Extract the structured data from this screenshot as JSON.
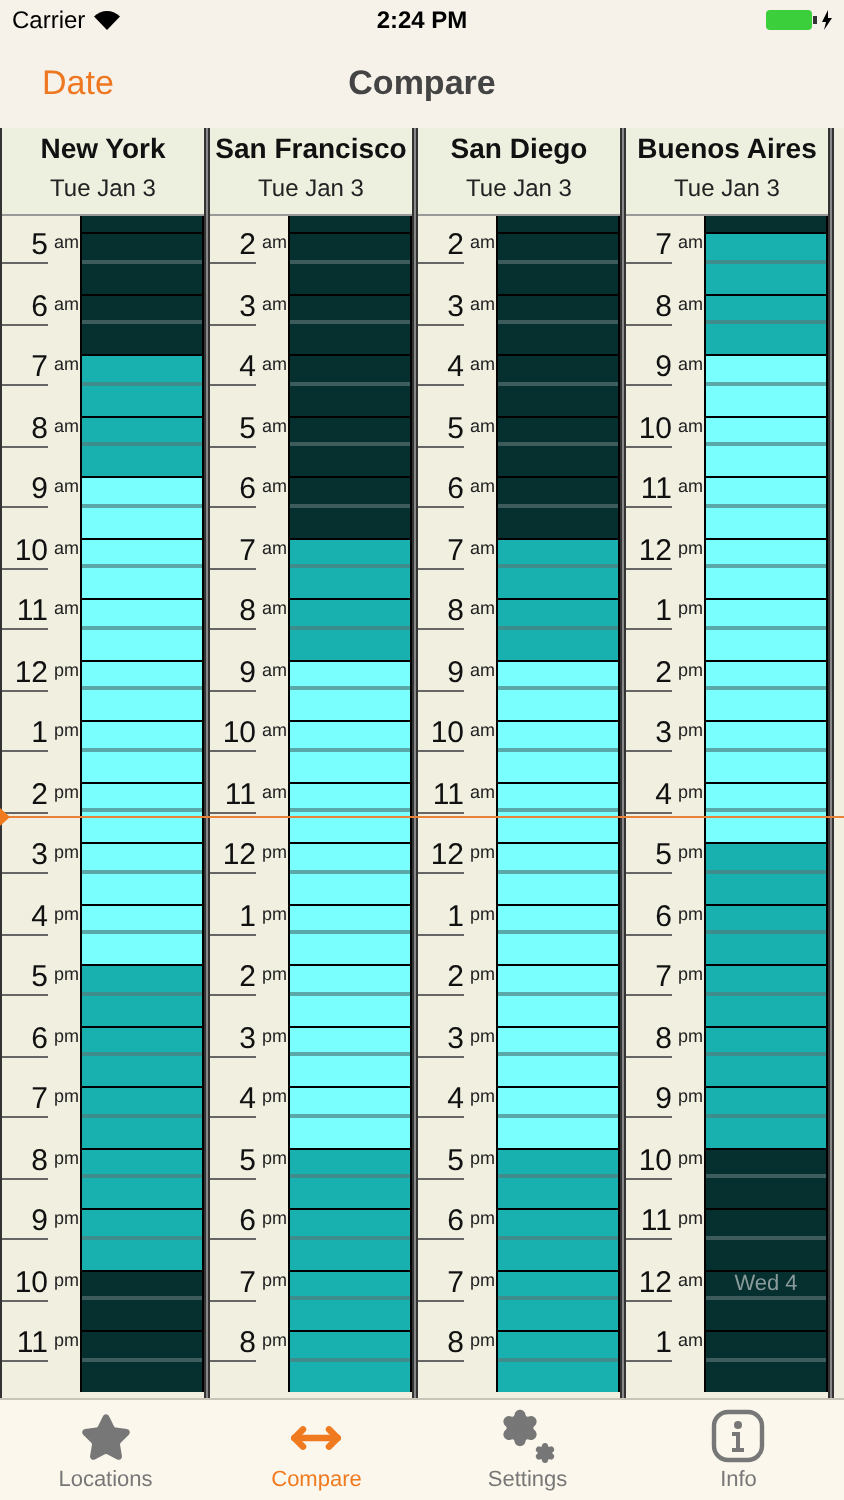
{
  "status_bar": {
    "carrier": "Carrier",
    "time": "2:24 PM"
  },
  "nav": {
    "left_button": "Date",
    "title": "Compare"
  },
  "columns": [
    {
      "name": "New York",
      "date": "Tue Jan 3",
      "leading": {
        "kind": "night"
      },
      "hours": [
        {
          "hour": "5",
          "period": "am",
          "kind": "night"
        },
        {
          "hour": "6",
          "period": "am",
          "kind": "night"
        },
        {
          "hour": "7",
          "period": "am",
          "kind": "twilight"
        },
        {
          "hour": "8",
          "period": "am",
          "kind": "twilight"
        },
        {
          "hour": "9",
          "period": "am",
          "kind": "day"
        },
        {
          "hour": "10",
          "period": "am",
          "kind": "day"
        },
        {
          "hour": "11",
          "period": "am",
          "kind": "day"
        },
        {
          "hour": "12",
          "period": "pm",
          "kind": "day"
        },
        {
          "hour": "1",
          "period": "pm",
          "kind": "day"
        },
        {
          "hour": "2",
          "period": "pm",
          "kind": "day"
        },
        {
          "hour": "3",
          "period": "pm",
          "kind": "day"
        },
        {
          "hour": "4",
          "period": "pm",
          "kind": "day"
        },
        {
          "hour": "5",
          "period": "pm",
          "kind": "twilight"
        },
        {
          "hour": "6",
          "period": "pm",
          "kind": "twilight"
        },
        {
          "hour": "7",
          "period": "pm",
          "kind": "twilight"
        },
        {
          "hour": "8",
          "period": "pm",
          "kind": "twilight"
        },
        {
          "hour": "9",
          "period": "pm",
          "kind": "twilight"
        },
        {
          "hour": "10",
          "period": "pm",
          "kind": "night"
        },
        {
          "hour": "11",
          "period": "pm",
          "kind": "night"
        }
      ]
    },
    {
      "name": "San Francisco",
      "date": "Tue Jan 3",
      "leading": {
        "kind": "night"
      },
      "hours": [
        {
          "hour": "2",
          "period": "am",
          "kind": "night"
        },
        {
          "hour": "3",
          "period": "am",
          "kind": "night"
        },
        {
          "hour": "4",
          "period": "am",
          "kind": "night"
        },
        {
          "hour": "5",
          "period": "am",
          "kind": "night"
        },
        {
          "hour": "6",
          "period": "am",
          "kind": "night"
        },
        {
          "hour": "7",
          "period": "am",
          "kind": "twilight"
        },
        {
          "hour": "8",
          "period": "am",
          "kind": "twilight"
        },
        {
          "hour": "9",
          "period": "am",
          "kind": "day"
        },
        {
          "hour": "10",
          "period": "am",
          "kind": "day"
        },
        {
          "hour": "11",
          "period": "am",
          "kind": "day"
        },
        {
          "hour": "12",
          "period": "pm",
          "kind": "day"
        },
        {
          "hour": "1",
          "period": "pm",
          "kind": "day"
        },
        {
          "hour": "2",
          "period": "pm",
          "kind": "day"
        },
        {
          "hour": "3",
          "period": "pm",
          "kind": "day"
        },
        {
          "hour": "4",
          "period": "pm",
          "kind": "day"
        },
        {
          "hour": "5",
          "period": "pm",
          "kind": "twilight"
        },
        {
          "hour": "6",
          "period": "pm",
          "kind": "twilight"
        },
        {
          "hour": "7",
          "period": "pm",
          "kind": "twilight"
        },
        {
          "hour": "8",
          "period": "pm",
          "kind": "twilight"
        }
      ]
    },
    {
      "name": "San Diego",
      "date": "Tue Jan 3",
      "leading": {
        "kind": "night"
      },
      "hours": [
        {
          "hour": "2",
          "period": "am",
          "kind": "night"
        },
        {
          "hour": "3",
          "period": "am",
          "kind": "night"
        },
        {
          "hour": "4",
          "period": "am",
          "kind": "night"
        },
        {
          "hour": "5",
          "period": "am",
          "kind": "night"
        },
        {
          "hour": "6",
          "period": "am",
          "kind": "night"
        },
        {
          "hour": "7",
          "period": "am",
          "kind": "twilight"
        },
        {
          "hour": "8",
          "period": "am",
          "kind": "twilight"
        },
        {
          "hour": "9",
          "period": "am",
          "kind": "day"
        },
        {
          "hour": "10",
          "period": "am",
          "kind": "day"
        },
        {
          "hour": "11",
          "period": "am",
          "kind": "day"
        },
        {
          "hour": "12",
          "period": "pm",
          "kind": "day"
        },
        {
          "hour": "1",
          "period": "pm",
          "kind": "day"
        },
        {
          "hour": "2",
          "period": "pm",
          "kind": "day"
        },
        {
          "hour": "3",
          "period": "pm",
          "kind": "day"
        },
        {
          "hour": "4",
          "period": "pm",
          "kind": "day"
        },
        {
          "hour": "5",
          "period": "pm",
          "kind": "twilight"
        },
        {
          "hour": "6",
          "period": "pm",
          "kind": "twilight"
        },
        {
          "hour": "7",
          "period": "pm",
          "kind": "twilight"
        },
        {
          "hour": "8",
          "period": "pm",
          "kind": "twilight"
        }
      ]
    },
    {
      "name": "Buenos Aires",
      "date": "Tue Jan 3",
      "leading": {
        "kind": "night"
      },
      "hours": [
        {
          "hour": "7",
          "period": "am",
          "kind": "twilight"
        },
        {
          "hour": "8",
          "period": "am",
          "kind": "twilight"
        },
        {
          "hour": "9",
          "period": "am",
          "kind": "day"
        },
        {
          "hour": "10",
          "period": "am",
          "kind": "day"
        },
        {
          "hour": "11",
          "period": "am",
          "kind": "day"
        },
        {
          "hour": "12",
          "period": "pm",
          "kind": "day"
        },
        {
          "hour": "1",
          "period": "pm",
          "kind": "day"
        },
        {
          "hour": "2",
          "period": "pm",
          "kind": "day"
        },
        {
          "hour": "3",
          "period": "pm",
          "kind": "day"
        },
        {
          "hour": "4",
          "period": "pm",
          "kind": "day"
        },
        {
          "hour": "5",
          "period": "pm",
          "kind": "twilight"
        },
        {
          "hour": "6",
          "period": "pm",
          "kind": "twilight"
        },
        {
          "hour": "7",
          "period": "pm",
          "kind": "twilight"
        },
        {
          "hour": "8",
          "period": "pm",
          "kind": "twilight"
        },
        {
          "hour": "9",
          "period": "pm",
          "kind": "twilight"
        },
        {
          "hour": "10",
          "period": "pm",
          "kind": "night"
        },
        {
          "hour": "11",
          "period": "pm",
          "kind": "night"
        },
        {
          "hour": "12",
          "period": "am",
          "kind": "night",
          "day_label": "Wed 4"
        },
        {
          "hour": "1",
          "period": "am",
          "kind": "night"
        }
      ]
    }
  ],
  "tabs": [
    {
      "label": "Locations",
      "kind": "star",
      "selected": false
    },
    {
      "label": "Compare",
      "kind": "arrows",
      "selected": true
    },
    {
      "label": "Settings",
      "kind": "gears",
      "selected": false
    },
    {
      "label": "Info",
      "kind": "info",
      "selected": false
    }
  ]
}
